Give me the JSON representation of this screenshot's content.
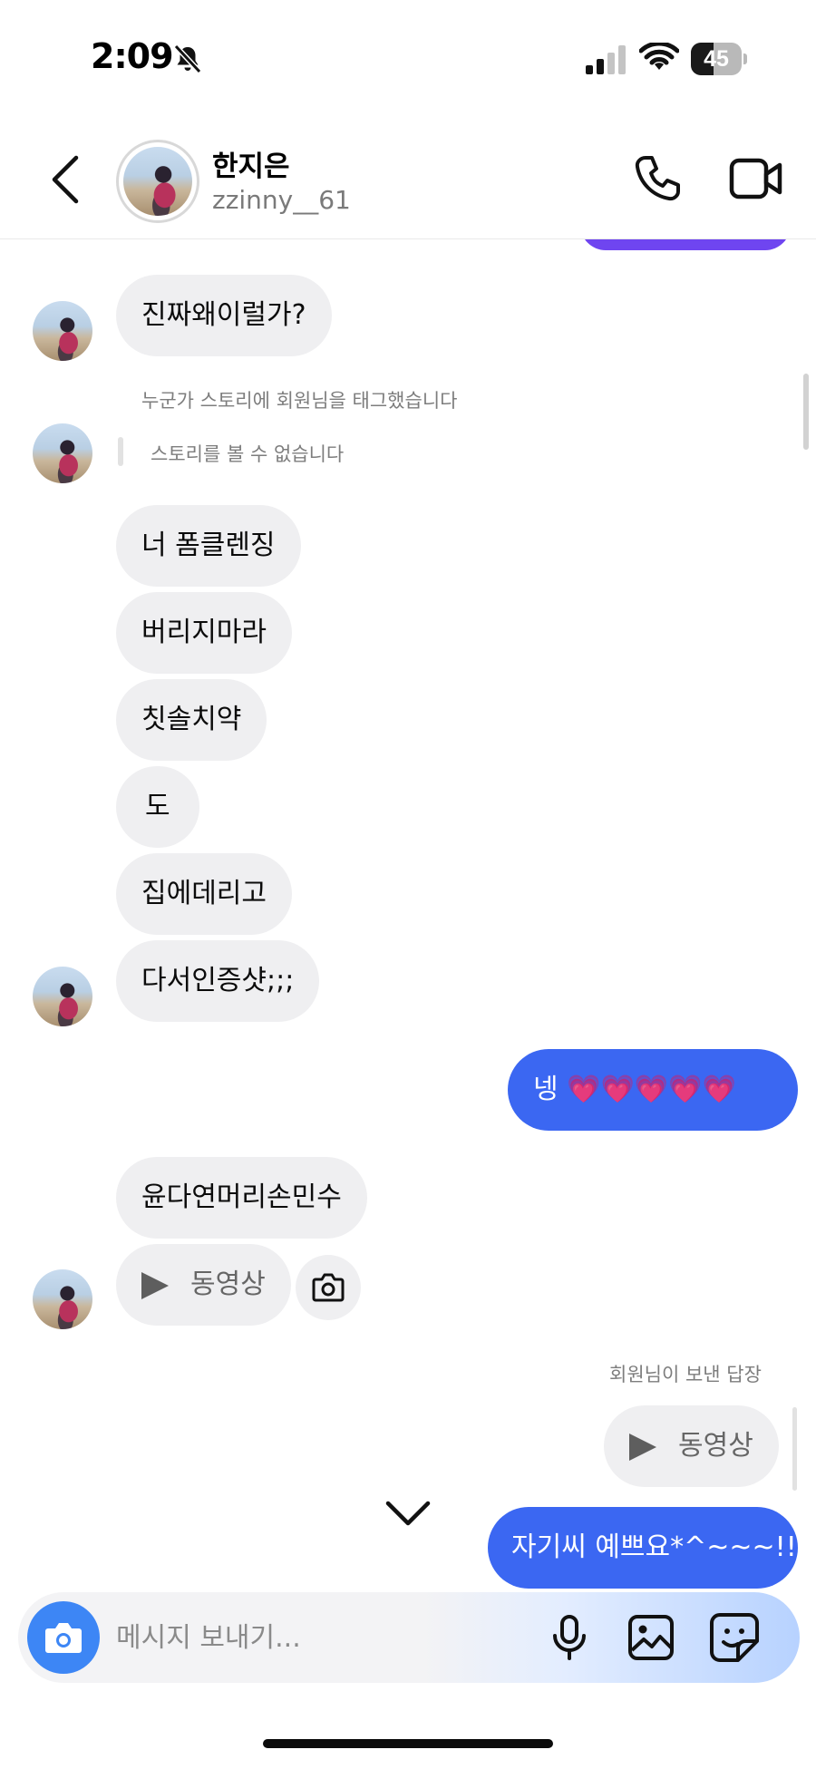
{
  "status_bar": {
    "time": "2:09",
    "battery": "45",
    "battery_level": 0.45
  },
  "header": {
    "display_name": "한지은",
    "username": "zzinny__61"
  },
  "messages": {
    "m1": "진짜왜이럴가?",
    "story_tag_notice": "누군가 스토리에 회원님을 태그했습니다",
    "story_unavailable": "스토리를 볼 수 없습니다",
    "m2": "너 폼클렌징",
    "m3": "버리지마라",
    "m4": "칫솔치약",
    "m5": "도",
    "m6": "집에데리고",
    "m7": "다서인증샷;;;",
    "mine1": "넹 💗💗💗💗💗",
    "m8": "윤다연머리손민수",
    "video_label": "동영상",
    "reply_notice": "회원님이 보낸 답장",
    "reply_video_label": "동영상",
    "mine2": "자기씨 예쁘요*^~~~!!"
  },
  "composer": {
    "placeholder": "메시지 보내기..."
  },
  "colors": {
    "my_bubble": "#3b67f2",
    "other_bubble": "#efeff1",
    "camera_button": "#3d86f5",
    "story_reply_accent": "#6f45f0"
  },
  "icons": [
    "bell-slash-icon",
    "cellular-signal-icon",
    "wifi-icon",
    "battery-icon",
    "back-chevron-icon",
    "phone-icon",
    "video-camera-icon",
    "play-icon",
    "camera-icon",
    "chevron-down-icon",
    "microphone-icon",
    "gallery-icon",
    "sticker-icon"
  ]
}
